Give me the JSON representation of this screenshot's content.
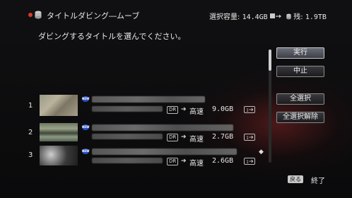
{
  "header": {
    "title": "タイトルダビング―ムーブ",
    "capacity_label": "選択容量:",
    "capacity_value": "14.4GB",
    "remain_label": "残:",
    "remain_value": "1.9TB"
  },
  "instruction": "ダビングするタイトルを選んでください。",
  "buttons": {
    "execute": "実行",
    "cancel": "中止",
    "select_all": "全選択",
    "deselect_all": "全選択解除"
  },
  "rows": [
    {
      "number": "1",
      "mode": "DR",
      "speed": "高速",
      "size": "9.0GB"
    },
    {
      "number": "2",
      "mode": "DR",
      "speed": "高速",
      "size": "2.7GB"
    },
    {
      "number": "3",
      "mode": "DR",
      "speed": "高速",
      "size": "2.6GB"
    }
  ],
  "footer": {
    "back_key": "戻る",
    "end_label": "終了"
  },
  "icons": [
    "record-dot-icon",
    "disk-icon",
    "copy-arrow-icon",
    "disk-icon",
    "new-icon",
    "arrow-right-icon",
    "single-dub-icon",
    "scroll-down-icon"
  ],
  "colors": {
    "accent": "#d83a2a",
    "new_badge": "#2850c8",
    "active_button": "#5a5e68"
  }
}
